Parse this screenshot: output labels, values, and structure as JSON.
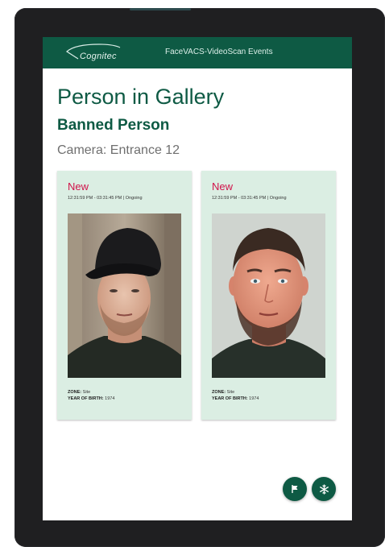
{
  "header": {
    "logo_text": "Cognitec",
    "title": "FaceVACS-VideoScan Events"
  },
  "main": {
    "title": "Person in Gallery",
    "subtitle": "Banned Person",
    "camera": "Camera: Entrance 12"
  },
  "cards": [
    {
      "status": "New",
      "time": "12:31:59 PM - 03:31:45 PM | Ongoing",
      "zone_label": "ZONE:",
      "zone_value": "Site",
      "yob_label": "YEAR OF BIRTH:",
      "yob_value": "1974",
      "photo": "live capture with cap"
    },
    {
      "status": "New",
      "time": "12:31:59 PM - 03:31:45 PM | Ongoing",
      "zone_label": "ZONE:",
      "zone_value": "Site",
      "yob_label": "YEAR OF BIRTH:",
      "yob_value": "1974",
      "photo": "gallery portrait"
    }
  ],
  "actions": {
    "flag_icon": "flag-icon",
    "snowflake_icon": "snowflake-icon"
  },
  "colors": {
    "brand": "#0e5a44",
    "status_new": "#d1124a",
    "card_bg": "#dbeee3"
  }
}
